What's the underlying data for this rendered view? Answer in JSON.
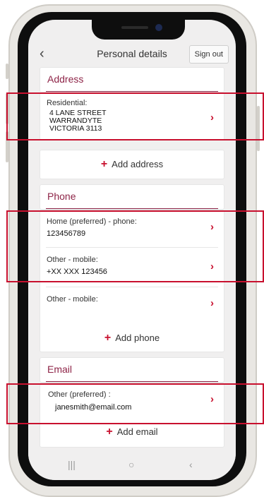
{
  "header": {
    "back_icon": "‹",
    "title": "Personal details",
    "sign_out": "Sign out"
  },
  "address": {
    "title": "Address",
    "residential_label": "Residential:",
    "lines": [
      "4 LANE STREET",
      "WARRANDYTE",
      "VICTORIA 3113"
    ],
    "add_label": "Add address"
  },
  "phone": {
    "title": "Phone",
    "items": [
      {
        "label": "Home (preferred) - phone:",
        "value": "123456789"
      },
      {
        "label": "Other - mobile:",
        "value": "+XX XXX 123456"
      },
      {
        "label": "Other - mobile:",
        "value": ""
      }
    ],
    "add_label": "Add phone"
  },
  "email": {
    "title": "Email",
    "item": {
      "label": "Other (preferred) :",
      "value": "janesmith@email.com"
    },
    "add_label": "Add email"
  },
  "icons": {
    "chevron": "›",
    "plus": "+",
    "nav_recents": "|||",
    "nav_home": "○",
    "nav_back": "‹"
  },
  "colors": {
    "accent": "#c8102e",
    "section_title": "#8e2447"
  }
}
